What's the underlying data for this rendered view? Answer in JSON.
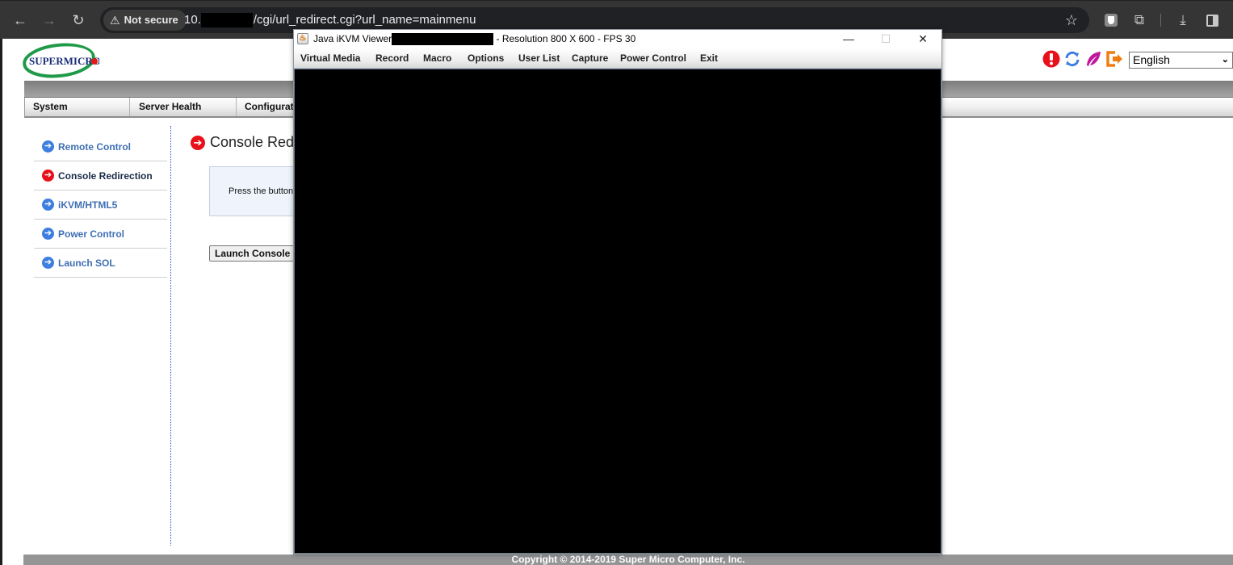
{
  "browser": {
    "back_icon": "←",
    "forward_icon": "→",
    "reload_icon": "↻",
    "security_warning_icon": "⚠",
    "security_label": "Not secure",
    "url_prefix": "10.",
    "url_path": "/cgi/url_redirect.cgi?url_name=mainmenu",
    "bookmark_icon": "☆",
    "extension_icon": "⧉",
    "download_icon": "⤓"
  },
  "page": {
    "logo_text": "SUPERMICRO",
    "language": {
      "selected": "English"
    },
    "top_icons": [
      {
        "name": "alert-icon",
        "color": "#e8101a"
      },
      {
        "name": "refresh-icon",
        "color": "#3d7ee0"
      },
      {
        "name": "feather-icon",
        "color": "#c0189c"
      },
      {
        "name": "logout-icon",
        "color": "#f07d12"
      }
    ],
    "menu": [
      {
        "label": "System"
      },
      {
        "label": "Server Health"
      },
      {
        "label": "Configuration"
      }
    ],
    "sidebar": [
      {
        "label": "Remote Control",
        "active": false
      },
      {
        "label": "Console Redirection",
        "active": true
      },
      {
        "label": "iKVM/HTML5",
        "active": false
      },
      {
        "label": "Power Control",
        "active": false
      },
      {
        "label": "Launch SOL",
        "active": false
      }
    ],
    "content": {
      "title": "Console Redirection",
      "info_text": "Press the button to launch the redirection console.",
      "launch_button": "Launch Console"
    },
    "footer": "Copyright © 2014-2019 Super Micro Computer, Inc."
  },
  "kvm": {
    "title_prefix": "Java iKVM Viewer",
    "title_suffix": " - Resolution 800 X 600 - FPS 30",
    "minimize_icon": "—",
    "maximize_icon": "☐",
    "close_icon": "✕",
    "menu": [
      {
        "label": "Virtual Media"
      },
      {
        "label": "Record"
      },
      {
        "label": "Macro"
      },
      {
        "label": "Options"
      },
      {
        "label": "User List"
      },
      {
        "label": "Capture"
      },
      {
        "label": "Power Control"
      },
      {
        "label": "Exit"
      }
    ]
  }
}
